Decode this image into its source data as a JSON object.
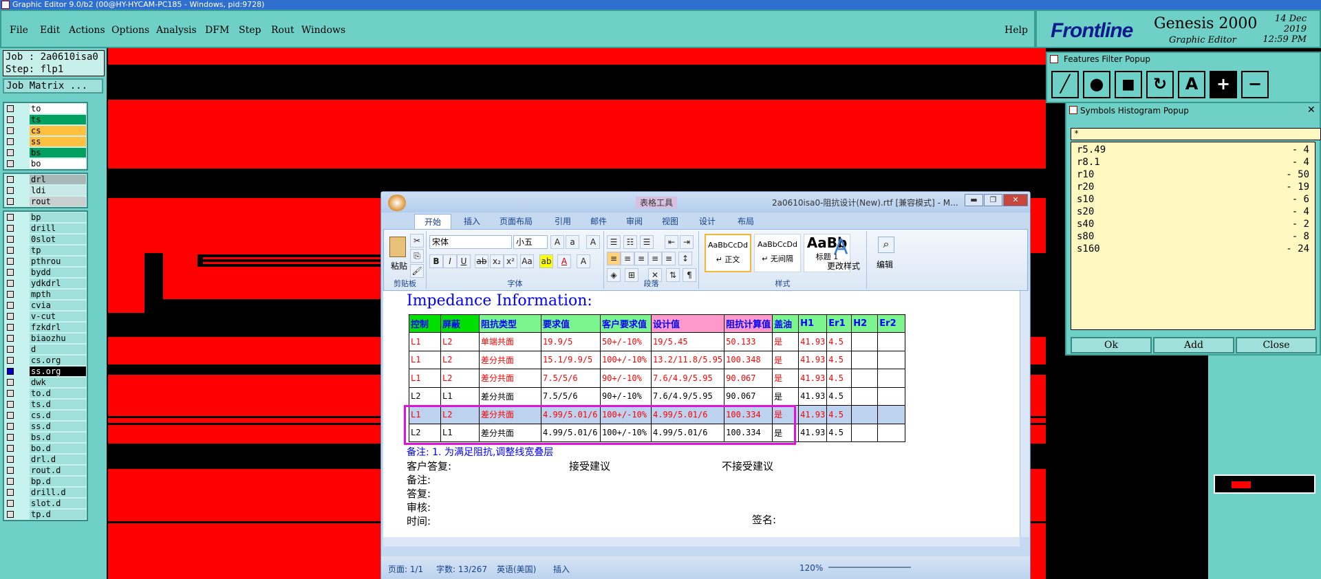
{
  "window": {
    "title": "Graphic Editor 9.0/b2 (00@HY-HYCAM-PC185 - Windows, pid:9728)"
  },
  "menu": [
    "File",
    "Edit",
    "Actions",
    "Options",
    "Analysis",
    "DFM",
    "Step",
    "Rout",
    "Windows"
  ],
  "help": "Help",
  "brand": {
    "logo": "Frontline",
    "product": "Genesis 2000",
    "subtitle": "Graphic Editor",
    "date": "14 Dec 2019",
    "time": "12:59 PM"
  },
  "left": {
    "job": "Job : 2a0610isa0",
    "step": "Step: flp1",
    "job_matrix": "Job Matrix ...",
    "group1": [
      {
        "n": "to",
        "c": "#ffffff"
      },
      {
        "n": "ts",
        "c": "#00a060"
      },
      {
        "n": "cs",
        "c": "#ffc040"
      },
      {
        "n": "ss",
        "c": "#ffc040"
      },
      {
        "n": "bs",
        "c": "#00a060"
      },
      {
        "n": "bo",
        "c": "#ffffff"
      }
    ],
    "group2": [
      {
        "n": "drl",
        "c": "#a8b8b8"
      },
      {
        "n": "ldi",
        "c": "#c8e8e8"
      },
      {
        "n": "rout",
        "c": "#c8d0d0"
      }
    ],
    "group3": [
      "bp",
      "drill",
      "0slot",
      "tp",
      "pthrou",
      "bydd",
      "ydkdrl",
      "mpth",
      "cvia",
      "v-cut",
      "fzkdrl",
      "biaozhu",
      "d",
      "cs.org",
      "ss.org",
      "dwk",
      "to.d",
      "ts.d",
      "cs.d",
      "ss.d",
      "bs.d",
      "bo.d",
      "drl.d",
      "rout.d",
      "bp.d",
      "drill.d",
      "slot.d",
      "tp.d"
    ]
  },
  "word": {
    "title": "2a0610isa0-阻抗设计(New).rtf [兼容模式] - M...",
    "context_tab": "表格工具",
    "tabs": [
      "开始",
      "插入",
      "页面布局",
      "引用",
      "邮件",
      "审阅",
      "视图",
      "设计",
      "布局"
    ],
    "font_name": "宋体",
    "font_size": "小五",
    "groups": [
      "剪贴板",
      "字体",
      "段落",
      "样式",
      "编辑"
    ],
    "paste": "粘贴",
    "styles": [
      {
        "sample": "AaBbCcDd",
        "name": "↵ 正文"
      },
      {
        "sample": "AaBbCcDd",
        "name": "↵ 无间隔"
      },
      {
        "sample": "AaBb",
        "name": "标题 1"
      }
    ],
    "change_styles": "更改样式",
    "edit": "编辑",
    "doc_title": "Impedance Information:",
    "headers": [
      "控制",
      "屏蔽",
      "阻抗类型",
      "要求值",
      "客户要求值",
      "设计值",
      "阻抗计算值",
      "盖油",
      "H1",
      "Er1",
      "H2",
      "Er2"
    ],
    "rows": [
      [
        "L1",
        "L2",
        "单端共面",
        "19.9/5",
        "50+/-10%",
        "19/5.45",
        "50.133",
        "是",
        "41.93",
        "4.5",
        "",
        ""
      ],
      [
        "L1",
        "L2",
        "差分共面",
        "15.1/9.9/5",
        "100+/-10%",
        "13.2/11.8/5.95",
        "100.348",
        "是",
        "41.93",
        "4.5",
        "",
        ""
      ],
      [
        "L1",
        "L2",
        "差分共面",
        "7.5/5/6",
        "90+/-10%",
        "7.6/4.9/5.95",
        "90.067",
        "是",
        "41.93",
        "4.5",
        "",
        ""
      ],
      [
        "L2",
        "L1",
        "差分共面",
        "7.5/5/6",
        "90+/-10%",
        "7.6/4.9/5.95",
        "90.067",
        "是",
        "41.93",
        "4.5",
        "",
        ""
      ],
      [
        "L1",
        "L2",
        "差分共面",
        "4.99/5.01/6",
        "100+/-10%",
        "4.99/5.01/6",
        "100.334",
        "是",
        "41.93",
        "4.5",
        "",
        ""
      ],
      [
        "L2",
        "L1",
        "差分共面",
        "4.99/5.01/6",
        "100+/-10%",
        "4.99/5.01/6",
        "100.334",
        "是",
        "41.93",
        "4.5",
        "",
        ""
      ]
    ],
    "note": "备注: 1. 为满足阻抗,调整线宽叠层",
    "reply": "客户答复:",
    "accept": "接受建议",
    "reject": "不接受建议",
    "remark": "备注:",
    "answer": "答复:",
    "review": "审核:",
    "time": "时间:",
    "sign": "签名:",
    "status": {
      "page": "页面: 1/1",
      "words": "字数: 13/267",
      "lang": "英语(美国)",
      "mode": "插入",
      "zoom": "120%"
    }
  },
  "features_filter": {
    "title": "Features Filter Popup"
  },
  "symbols": {
    "title": "Symbols Histogram Popup",
    "filter": "*",
    "items": [
      {
        "s": "r5.49",
        "c": "- 4"
      },
      {
        "s": "r8.1",
        "c": "- 4"
      },
      {
        "s": "r10",
        "c": "- 50"
      },
      {
        "s": "r20",
        "c": "- 19"
      },
      {
        "s": "s10",
        "c": "- 6"
      },
      {
        "s": "s20",
        "c": "- 4"
      },
      {
        "s": "s40",
        "c": "- 2"
      },
      {
        "s": "s80",
        "c": "- 8"
      },
      {
        "s": "s160",
        "c": "- 24"
      }
    ],
    "ok": "Ok",
    "add": "Add",
    "close": "Close"
  }
}
